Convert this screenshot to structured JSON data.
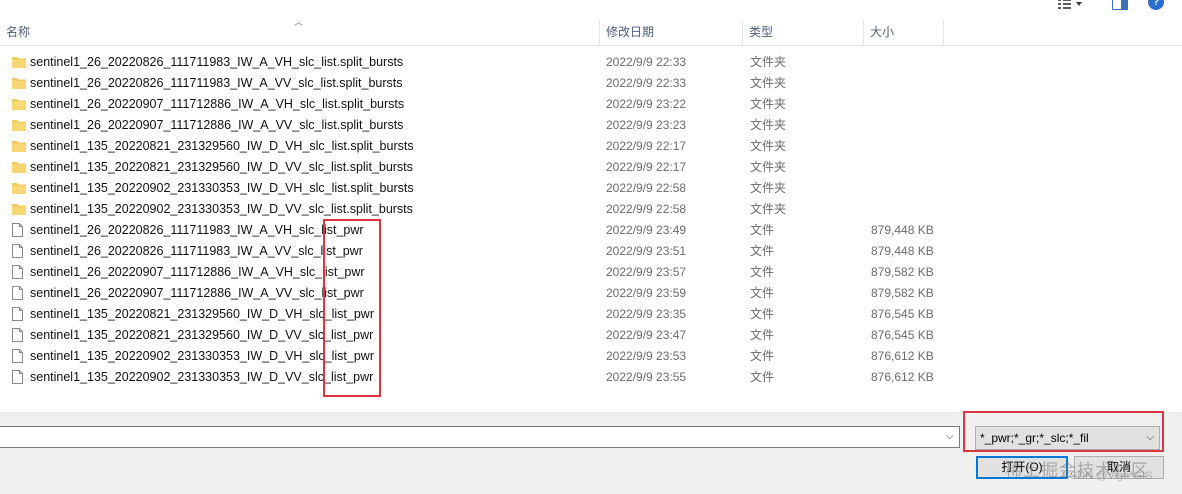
{
  "header": {
    "columns": [
      "名称",
      "修改日期",
      "类型",
      "大小"
    ]
  },
  "files": [
    {
      "kind": "folder",
      "name": "sentinel1_26_20220826_111711983_IW_A_VH_slc_list.split_bursts",
      "date": "2022/9/9 22:33",
      "type": "文件夹",
      "size": ""
    },
    {
      "kind": "folder",
      "name": "sentinel1_26_20220826_111711983_IW_A_VV_slc_list.split_bursts",
      "date": "2022/9/9 22:33",
      "type": "文件夹",
      "size": ""
    },
    {
      "kind": "folder",
      "name": "sentinel1_26_20220907_111712886_IW_A_VH_slc_list.split_bursts",
      "date": "2022/9/9 23:22",
      "type": "文件夹",
      "size": ""
    },
    {
      "kind": "folder",
      "name": "sentinel1_26_20220907_111712886_IW_A_VV_slc_list.split_bursts",
      "date": "2022/9/9 23:23",
      "type": "文件夹",
      "size": ""
    },
    {
      "kind": "folder",
      "name": "sentinel1_135_20220821_231329560_IW_D_VH_slc_list.split_bursts",
      "date": "2022/9/9 22:17",
      "type": "文件夹",
      "size": ""
    },
    {
      "kind": "folder",
      "name": "sentinel1_135_20220821_231329560_IW_D_VV_slc_list.split_bursts",
      "date": "2022/9/9 22:17",
      "type": "文件夹",
      "size": ""
    },
    {
      "kind": "folder",
      "name": "sentinel1_135_20220902_231330353_IW_D_VH_slc_list.split_bursts",
      "date": "2022/9/9 22:58",
      "type": "文件夹",
      "size": ""
    },
    {
      "kind": "folder",
      "name": "sentinel1_135_20220902_231330353_IW_D_VV_slc_list.split_bursts",
      "date": "2022/9/9 22:58",
      "type": "文件夹",
      "size": ""
    },
    {
      "kind": "file",
      "name": "sentinel1_26_20220826_111711983_IW_A_VH_slc_list_pwr",
      "date": "2022/9/9 23:49",
      "type": "文件",
      "size": "879,448 KB"
    },
    {
      "kind": "file",
      "name": "sentinel1_26_20220826_111711983_IW_A_VV_slc_list_pwr",
      "date": "2022/9/9 23:51",
      "type": "文件",
      "size": "879,448 KB"
    },
    {
      "kind": "file",
      "name": "sentinel1_26_20220907_111712886_IW_A_VH_slc_list_pwr",
      "date": "2022/9/9 23:57",
      "type": "文件",
      "size": "879,582 KB"
    },
    {
      "kind": "file",
      "name": "sentinel1_26_20220907_111712886_IW_A_VV_slc_list_pwr",
      "date": "2022/9/9 23:59",
      "type": "文件",
      "size": "879,582 KB"
    },
    {
      "kind": "file",
      "name": "sentinel1_135_20220821_231329560_IW_D_VH_slc_list_pwr",
      "date": "2022/9/9 23:35",
      "type": "文件",
      "size": "876,545 KB"
    },
    {
      "kind": "file",
      "name": "sentinel1_135_20220821_231329560_IW_D_VV_slc_list_pwr",
      "date": "2022/9/9 23:47",
      "type": "文件",
      "size": "876,545 KB"
    },
    {
      "kind": "file",
      "name": "sentinel1_135_20220902_231330353_IW_D_VH_slc_list_pwr",
      "date": "2022/9/9 23:53",
      "type": "文件",
      "size": "876,612 KB"
    },
    {
      "kind": "file",
      "name": "sentinel1_135_20220902_231330353_IW_D_VV_slc_list_pwr",
      "date": "2022/9/9 23:55",
      "type": "文件",
      "size": "876,612 KB"
    }
  ],
  "footer": {
    "filename_value": "",
    "filter_value": "*_pwr;*_gr;*_slc;*_fil",
    "open_label": "打开(O)",
    "cancel_label": "取消",
    "watermark": "稀土掘金技术社区",
    "watermark_sub": "CSDN @Vigo*GIS"
  },
  "colors": {
    "highlight": "#d9363e",
    "folder": "#f0c75e",
    "focus": "#0078d7"
  },
  "icons": {
    "folder": "folder-icon",
    "file": "file-icon",
    "view": "view-options-icon",
    "preview": "preview-pane-icon",
    "help": "help-icon"
  }
}
